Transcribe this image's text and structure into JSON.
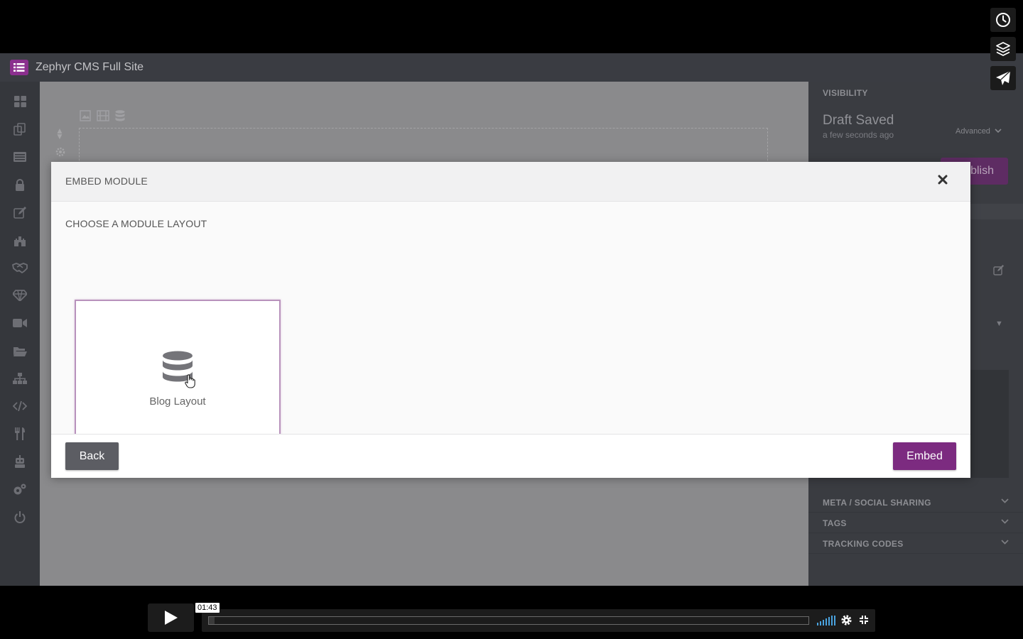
{
  "app": {
    "title": "Zephyr CMS Full Site",
    "nav_icons": [
      "dashboard-icon",
      "pages-icon",
      "list-icon",
      "lock-icon",
      "edit-icon",
      "castle-icon",
      "handshake-icon",
      "diamond-icon",
      "video-icon",
      "folder-icon",
      "sitemap-icon",
      "code-icon",
      "utensils-icon",
      "robot-icon",
      "settings-icon",
      "power-icon"
    ]
  },
  "canvas": {
    "tool_icons": [
      "image-icon",
      "film-icon",
      "database-icon"
    ]
  },
  "right_panel": {
    "visibility_label": "VISIBILITY",
    "status": "Draft Saved",
    "status_time": "a few seconds ago",
    "advanced_label": "Advanced",
    "publish_label": "blish",
    "sections": [
      "META / SOCIAL SHARING",
      "TAGS",
      "TRACKING CODES"
    ]
  },
  "modal": {
    "title": "EMBED MODULE",
    "subtitle": "CHOOSE A MODULE LAYOUT",
    "layouts": [
      {
        "label": "Blog Layout",
        "icon": "database-icon",
        "selected": true
      }
    ],
    "back_label": "Back",
    "embed_label": "Embed"
  },
  "player": {
    "timecode": "01:43",
    "progress": 0.01,
    "side_buttons": [
      "clock-icon",
      "layers-icon",
      "send-icon"
    ]
  },
  "colors": {
    "accent": "#7c2b80",
    "back_button": "#5c5d63",
    "volume": "#4aa3df"
  }
}
